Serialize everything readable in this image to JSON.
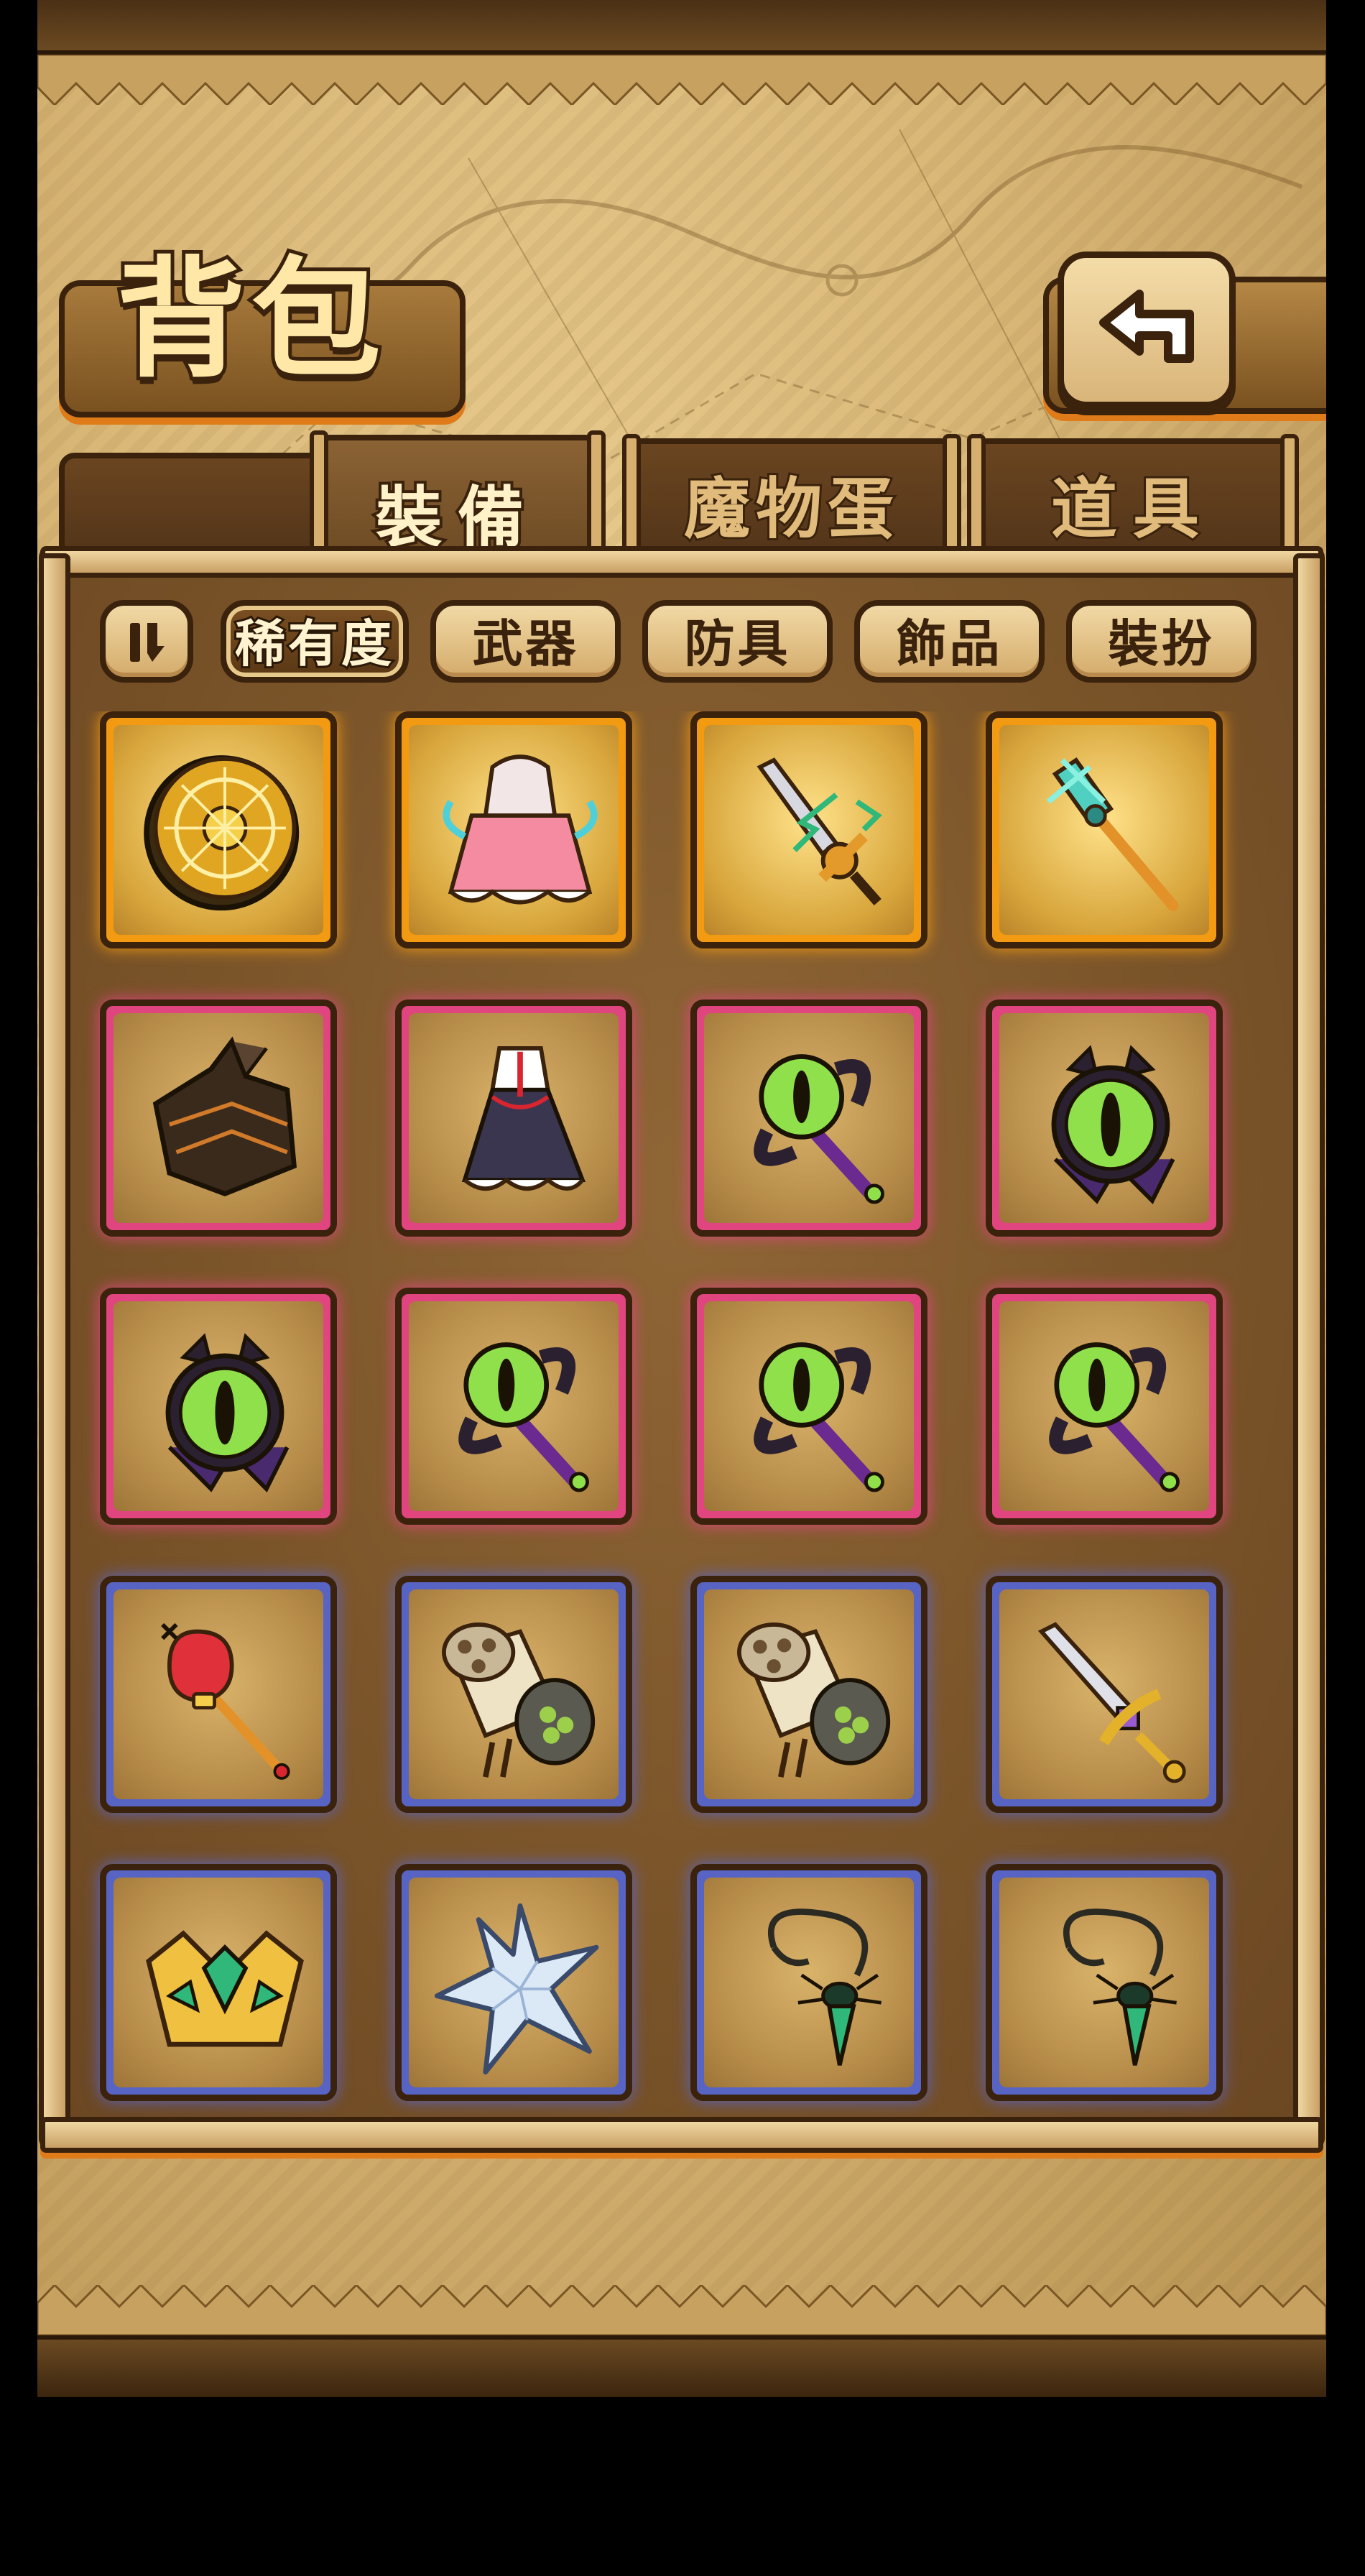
{
  "title": "背包",
  "back_button": {
    "icon": "back-arrow-icon"
  },
  "tabs": [
    {
      "label": "",
      "active": false
    },
    {
      "label": "裝備",
      "active": true
    },
    {
      "label": "魔物蛋",
      "active": false
    },
    {
      "label": "道具",
      "active": false
    }
  ],
  "sort_button": {
    "icon": "sort-toggle-icon"
  },
  "filters": [
    {
      "label": "稀有度",
      "selected": true
    },
    {
      "label": "武器",
      "selected": false
    },
    {
      "label": "防具",
      "selected": false
    },
    {
      "label": "飾品",
      "selected": false
    },
    {
      "label": "裝扮",
      "selected": false
    }
  ],
  "rarity_colors": {
    "legendary": "#f29a12",
    "epic": "#e0457f",
    "rare": "#5864c4"
  },
  "items": [
    {
      "rarity": "legendary",
      "icon": "golden-clock-coin-icon"
    },
    {
      "rarity": "legendary",
      "icon": "pink-frilly-hood-dress-icon"
    },
    {
      "rarity": "legendary",
      "icon": "green-lightning-sword-icon"
    },
    {
      "rarity": "legendary",
      "icon": "crystal-trident-staff-icon"
    },
    {
      "rarity": "epic",
      "icon": "dark-spiked-armor-icon"
    },
    {
      "rarity": "epic",
      "icon": "maid-dress-icon"
    },
    {
      "rarity": "epic",
      "icon": "eye-orb-staff-icon"
    },
    {
      "rarity": "epic",
      "icon": "eye-amulet-icon"
    },
    {
      "rarity": "epic",
      "icon": "eye-amulet-icon"
    },
    {
      "rarity": "epic",
      "icon": "eye-orb-staff-icon"
    },
    {
      "rarity": "epic",
      "icon": "eye-orb-staff-icon"
    },
    {
      "rarity": "epic",
      "icon": "eye-orb-staff-icon"
    },
    {
      "rarity": "rare",
      "icon": "red-crown-scepter-icon"
    },
    {
      "rarity": "rare",
      "icon": "gatling-cannon-icon"
    },
    {
      "rarity": "rare",
      "icon": "gatling-cannon-icon"
    },
    {
      "rarity": "rare",
      "icon": "gold-hilt-sword-icon"
    },
    {
      "rarity": "rare",
      "icon": "emerald-tiara-icon"
    },
    {
      "rarity": "rare",
      "icon": "ice-crystal-star-icon"
    },
    {
      "rarity": "rare",
      "icon": "spider-gem-necklace-icon"
    },
    {
      "rarity": "rare",
      "icon": "spider-gem-necklace-icon"
    }
  ]
}
